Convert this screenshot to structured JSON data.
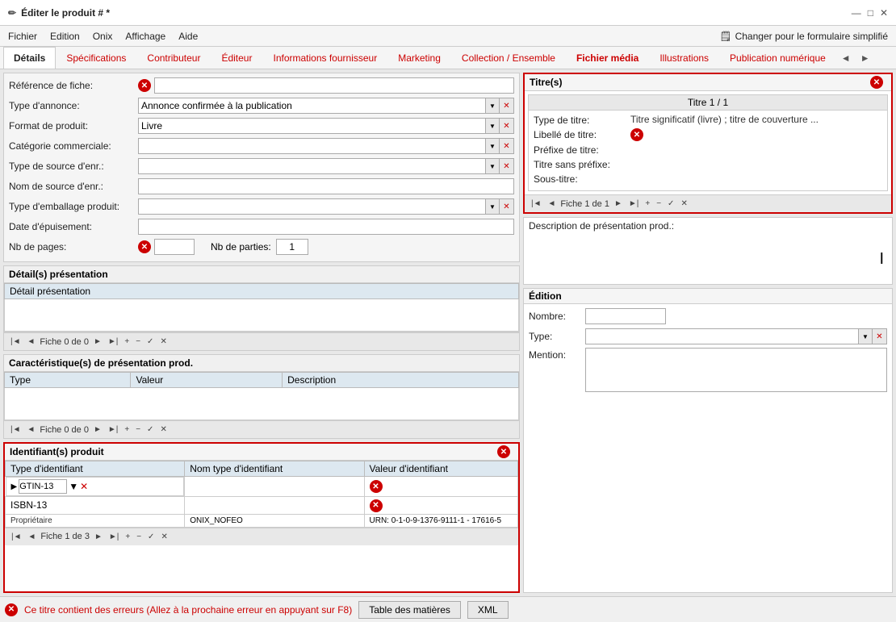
{
  "titleBar": {
    "title": "Éditer le produit # *",
    "editIcon": "✏",
    "buttons": [
      "—",
      "□",
      "✕"
    ]
  },
  "menuBar": {
    "items": [
      "Fichier",
      "Edition",
      "Onix",
      "Affichage",
      "Aide"
    ],
    "simplify": "Changer pour le formulaire simplifié",
    "simplifyIcon": "🗒"
  },
  "tabs": {
    "items": [
      {
        "label": "Détails",
        "active": true,
        "color": "normal"
      },
      {
        "label": "Spécifications",
        "active": false,
        "color": "red"
      },
      {
        "label": "Contributeur",
        "active": false,
        "color": "red"
      },
      {
        "label": "Éditeur",
        "active": false,
        "color": "red"
      },
      {
        "label": "Informations fournisseur",
        "active": false,
        "color": "red"
      },
      {
        "label": "Marketing",
        "active": false,
        "color": "red"
      },
      {
        "label": "Collection / Ensemble",
        "active": false,
        "color": "red"
      },
      {
        "label": "Fichier média",
        "active": false,
        "color": "red"
      },
      {
        "label": "Illustrations",
        "active": false,
        "color": "normal"
      },
      {
        "label": "Publication numérique",
        "active": false,
        "color": "normal"
      }
    ]
  },
  "leftPanel": {
    "fields": [
      {
        "label": "Référence de fiche:",
        "type": "input-with-error",
        "hasError": true,
        "value": ""
      },
      {
        "label": "Type d'annonce:",
        "type": "dropdown",
        "value": "Annonce confirmée à la publication"
      },
      {
        "label": "Format de produit:",
        "type": "dropdown",
        "value": "Livre"
      },
      {
        "label": "Catégorie commerciale:",
        "type": "dropdown",
        "value": ""
      },
      {
        "label": "Type de source d'enr.:",
        "type": "dropdown",
        "value": ""
      },
      {
        "label": "Nom de source d'enr.:",
        "type": "input",
        "value": ""
      },
      {
        "label": "Type d'emballage produit:",
        "type": "dropdown",
        "value": ""
      },
      {
        "label": "Date d'épuisement:",
        "type": "input-small",
        "value": ""
      }
    ],
    "nbPages": {
      "label": "Nb de pages:",
      "hasError": true,
      "nbParties": {
        "label": "Nb de parties:",
        "value": "1"
      }
    },
    "detailPresentation": {
      "title": "Détail(s) présentation",
      "columnHeader": "Détail présentation",
      "nav": "Fiche 0 de 0"
    },
    "caracteristiques": {
      "title": "Caractéristique(s) de présentation prod.",
      "columns": [
        "Type",
        "Valeur",
        "Description"
      ],
      "nav": "Fiche 0 de 0"
    },
    "identifiants": {
      "title": "Identifiant(s) produit",
      "columns": [
        "Type d'identifiant",
        "Nom type d'identifiant",
        "Valeur d'identifiant"
      ],
      "rows": [
        {
          "type": "GTIN-13",
          "nom": "",
          "valeur": "",
          "hasError": true,
          "selected": true
        },
        {
          "type": "ISBN-13",
          "nom": "",
          "valeur": "",
          "hasError": true,
          "selected": false
        },
        {
          "type": "Propriétaire",
          "nom": "ONIX_NOFEO",
          "valeur": "URN: 0-1-0-9-1376-9111-1 - 17616-5",
          "hasError": false,
          "selected": false
        }
      ],
      "nav": "Fiche 1 de 3"
    }
  },
  "rightPanel": {
    "titres": {
      "title": "Titre(s)",
      "card": {
        "header": "Titre 1 / 1",
        "fields": [
          {
            "label": "Type de titre:",
            "value": "Titre significatif (livre) ; titre de couverture ..."
          },
          {
            "label": "Libellé de titre:",
            "value": "",
            "hasError": true
          },
          {
            "label": "Préfixe de titre:",
            "value": ""
          },
          {
            "label": "Titre sans préfixe:",
            "value": ""
          },
          {
            "label": "Sous-titre:",
            "value": ""
          }
        ]
      },
      "nav": "Fiche 1 de 1"
    },
    "description": {
      "label": "Description de présentation prod.:",
      "value": "",
      "cursorVisible": true
    },
    "edition": {
      "title": "Édition",
      "fields": [
        {
          "label": "Nombre:",
          "value": ""
        },
        {
          "label": "Type:",
          "value": ""
        },
        {
          "label": "Mention:",
          "value": ""
        }
      ]
    }
  },
  "bottomBar": {
    "errorText": "Ce titre contient des erreurs (Allez à la prochaine erreur en appuyant sur F8)",
    "buttons": [
      "Table des matières",
      "XML"
    ]
  },
  "navSymbols": {
    "first": "|◄",
    "prev": "◄",
    "next": "►",
    "last": "►|",
    "add": "+",
    "delete": "−",
    "check": "✓",
    "cancel": "✕"
  }
}
